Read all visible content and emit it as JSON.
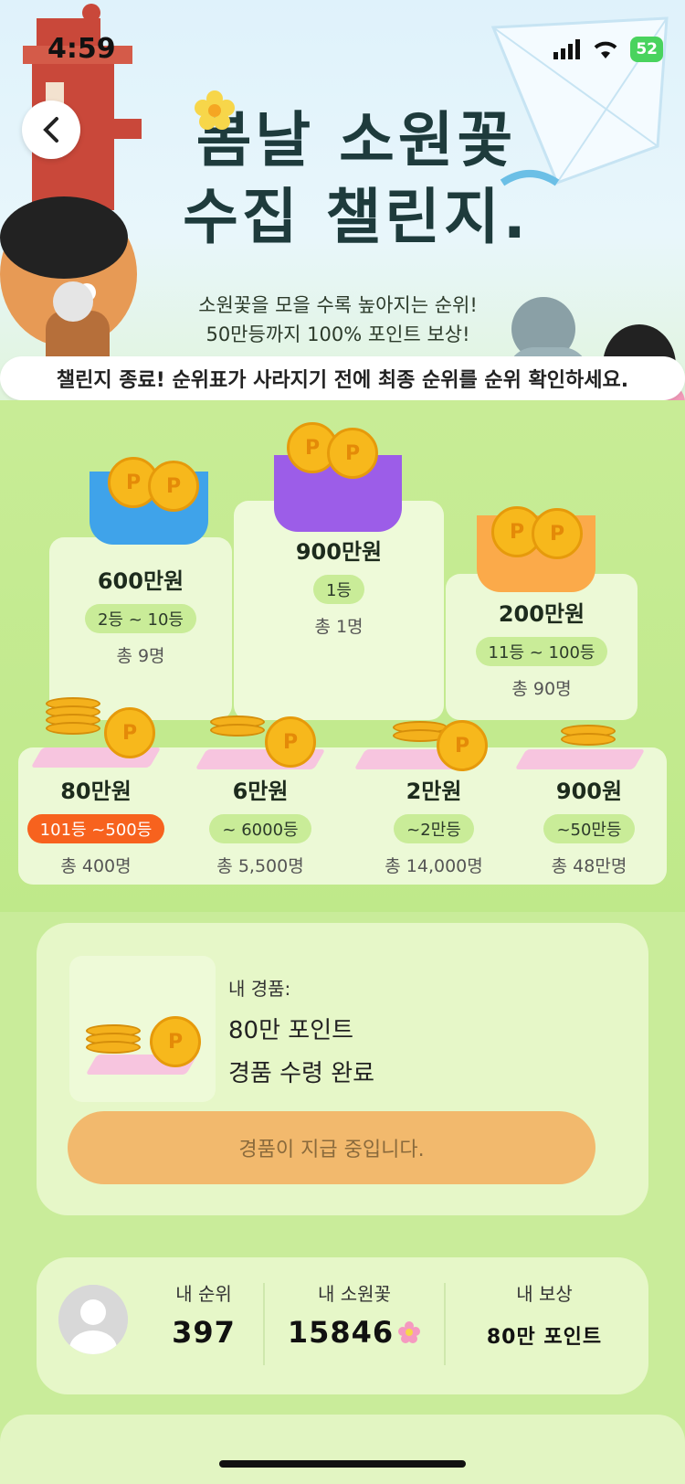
{
  "status_bar": {
    "time": "4:59",
    "battery": "52"
  },
  "header": {
    "title_line1": "봄날 소원꽃",
    "title_line2": "수집 챌린지.",
    "subtitle_line1": "소원꽃을 모을 수록 높아지는 순위!",
    "subtitle_line2": "50만등까지 100% 포인트 보상!",
    "notice": "챌린지 종료! 순위표가 사라지기 전에 최종 순위를 순위 확인하세요."
  },
  "top_prizes": [
    {
      "amount": "600만원",
      "rank": "2등 ~ 10등",
      "count": "총 9명"
    },
    {
      "amount": "900만원",
      "rank": "1등",
      "count": "총 1명"
    },
    {
      "amount": "200만원",
      "rank": "11등 ~ 100등",
      "count": "총 90명"
    }
  ],
  "lower_prizes": [
    {
      "amount": "80만원",
      "rank": "101등 ~500등",
      "count": "총 400명",
      "active": true
    },
    {
      "amount": "6만원",
      "rank": "~ 6000등",
      "count": "총 5,500명"
    },
    {
      "amount": "2만원",
      "rank": "~2만등",
      "count": "총 14,000명"
    },
    {
      "amount": "900원",
      "rank": "~50만등",
      "count": "총 48만명"
    }
  ],
  "my_prize": {
    "label": "내 경품:",
    "name": "80만 포인트",
    "status": "경품 수령 완료",
    "button": "경품이 지급 중입니다."
  },
  "my_stats": {
    "rank_label": "내 순위",
    "rank_value": "397",
    "flowers_label": "내 소원꽃",
    "flowers_value": "15846",
    "reward_label": "내 보상",
    "reward_value": "80만 포인트"
  },
  "colors": {
    "accent": "#f7621e",
    "button": "#f2b96d",
    "background": "#c9ec9a",
    "card": "#e6f7c8"
  }
}
